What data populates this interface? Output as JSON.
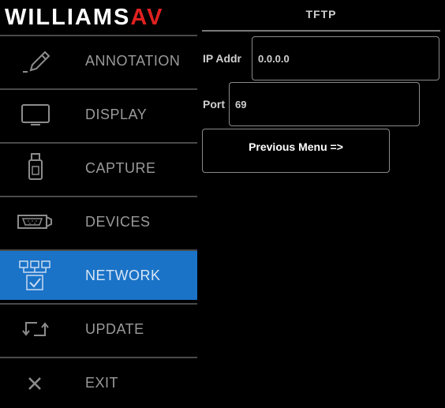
{
  "brand": {
    "name_main": "WILLIAMS",
    "name_accent": "AV"
  },
  "sidebar": {
    "items": [
      {
        "label": "ANNOTATION",
        "icon": "pencil-icon"
      },
      {
        "label": "DISPLAY",
        "icon": "monitor-icon"
      },
      {
        "label": "CAPTURE",
        "icon": "usb-drive-icon"
      },
      {
        "label": "DEVICES",
        "icon": "vga-connector-icon"
      },
      {
        "label": "NETWORK",
        "icon": "network-icon",
        "active": true
      },
      {
        "label": "UPDATE",
        "icon": "update-arrows-icon"
      },
      {
        "label": "EXIT",
        "icon": "close-icon"
      }
    ],
    "active_color": "#1a73c7"
  },
  "panel": {
    "title": "TFTP",
    "ip_label": "IP Addr",
    "ip_value": "0.0.0.0",
    "port_label": "Port",
    "port_value": "69",
    "previous_menu": "Previous Menu =>"
  }
}
